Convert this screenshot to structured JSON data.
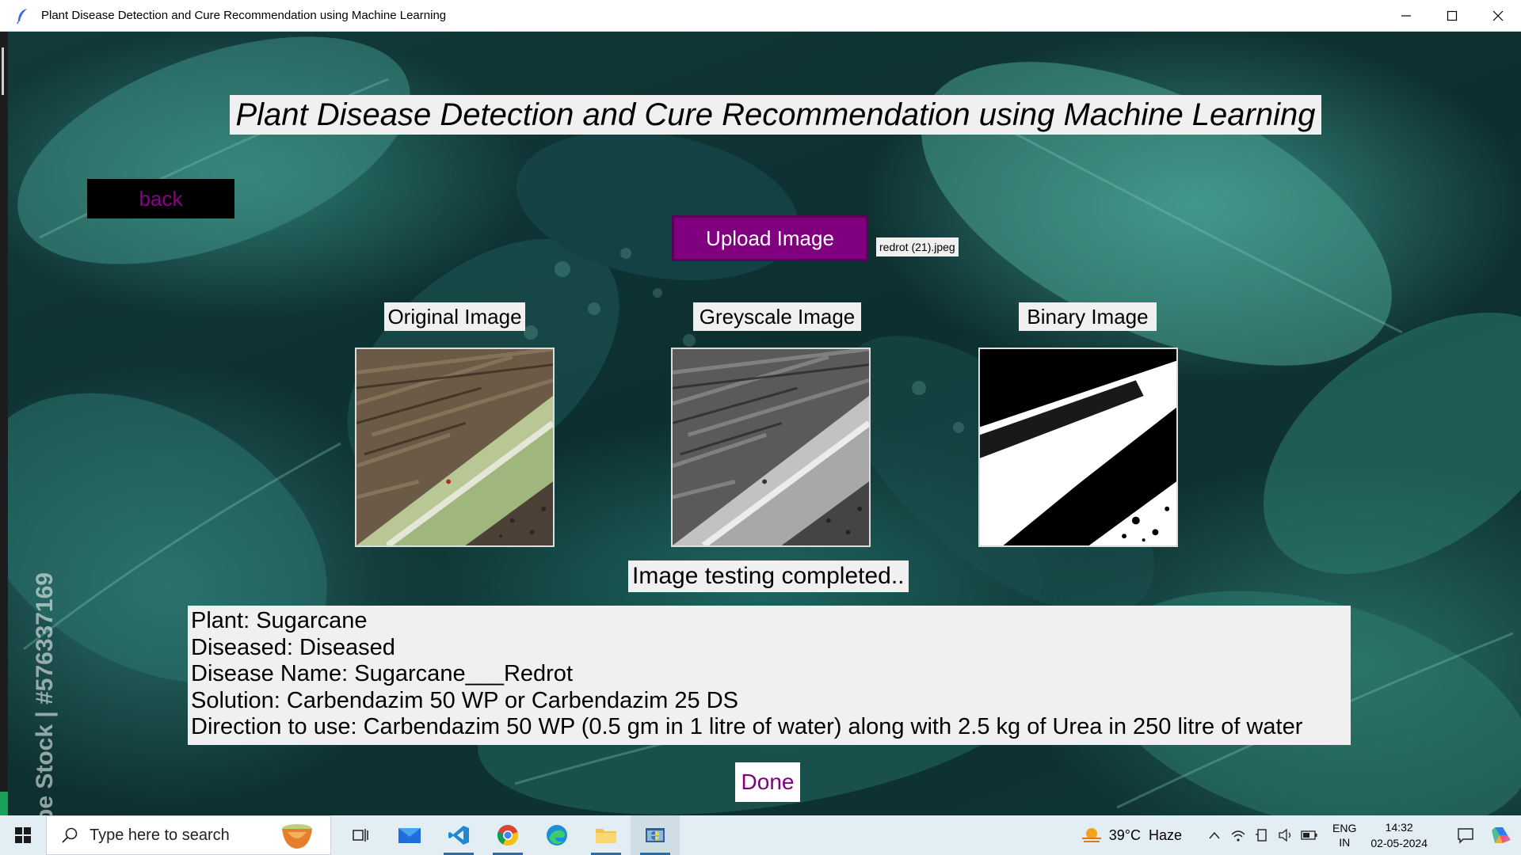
{
  "window": {
    "title": "Plant Disease Detection and Cure Recommendation using Machine Learning"
  },
  "app": {
    "heading": "Plant Disease Detection and Cure Recommendation using Machine Learning",
    "back_label": "back",
    "upload_label": "Upload Image",
    "filename": "redrot (21).jpeg",
    "images": {
      "original_label": "Original Image",
      "greyscale_label": "Greyscale Image",
      "binary_label": "Binary Image"
    },
    "status": "Image testing completed..",
    "results": {
      "plant": "Plant: Sugarcane",
      "diseased": "Diseased: Diseased",
      "disease_name": "Disease Name: Sugarcane___Redrot",
      "solution": "Solution: Carbendazim 50 WP or Carbendazim 25 DS",
      "direction": "Direction to use: Carbendazim 50 WP (0.5 gm in 1 litre of water) along with 2.5 kg of Urea in 250 litre of water"
    },
    "done_label": "Done",
    "watermark": "be Stock | #576337169"
  },
  "colors": {
    "accent_purple": "#800080",
    "label_bg": "#f0f0f0",
    "back_bg": "#000000"
  },
  "taskbar": {
    "search_placeholder": "Type here to search",
    "weather_temp": "39°C",
    "weather_condition": "Haze",
    "lang_primary": "ENG",
    "lang_region": "IN",
    "time": "14:32",
    "date": "02-05-2024",
    "apps": [
      "task-view",
      "mail",
      "vscode",
      "chrome",
      "edge",
      "file-explorer",
      "python"
    ]
  }
}
